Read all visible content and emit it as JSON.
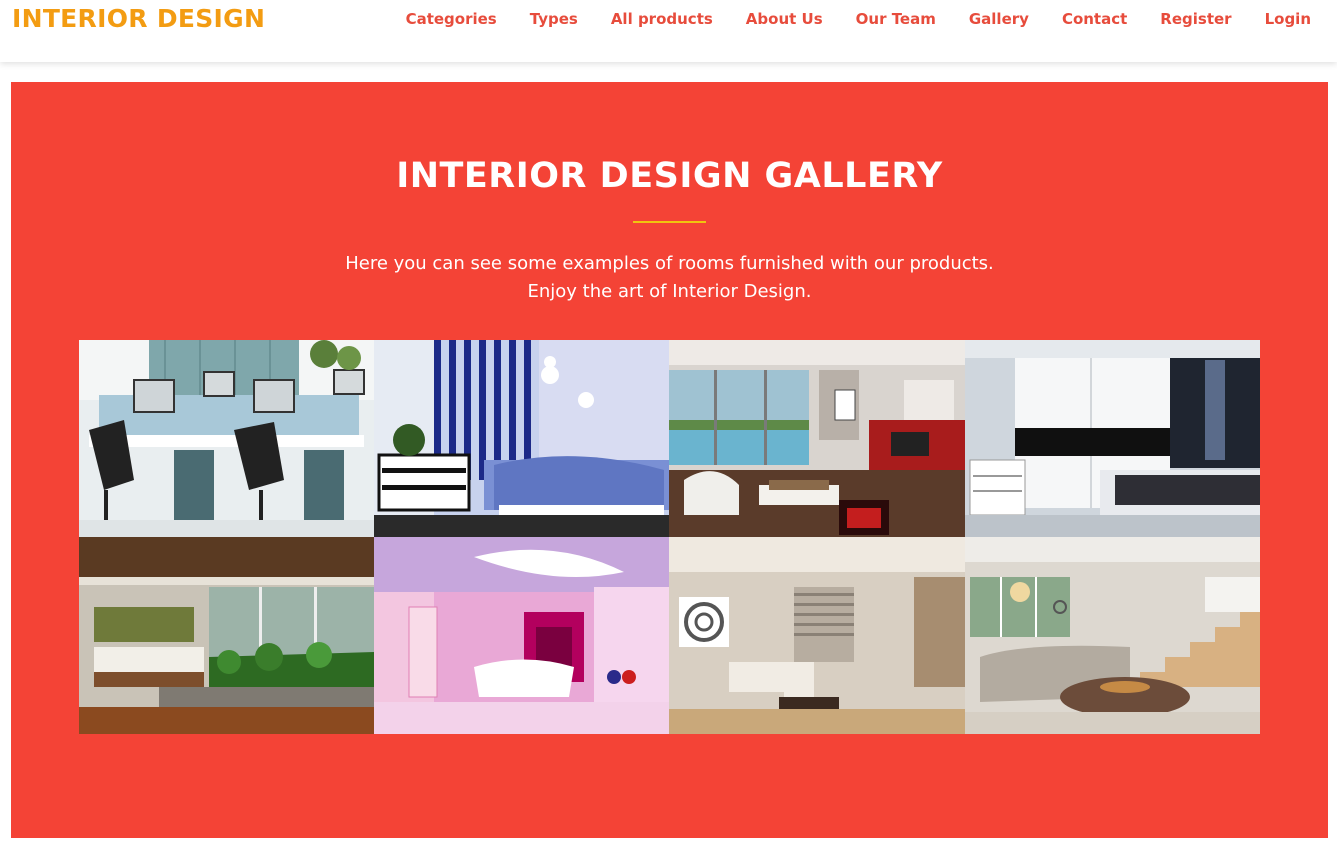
{
  "brand": {
    "name": "INTERIOR DESIGN"
  },
  "nav": {
    "items": [
      {
        "label": "Categories",
        "id": "categories"
      },
      {
        "label": "Types",
        "id": "types"
      },
      {
        "label": "All products",
        "id": "all-products"
      },
      {
        "label": "About Us",
        "id": "about-us"
      },
      {
        "label": "Our Team",
        "id": "our-team"
      },
      {
        "label": "Gallery",
        "id": "gallery"
      },
      {
        "label": "Contact",
        "id": "contact"
      },
      {
        "label": "Register",
        "id": "register"
      },
      {
        "label": "Login",
        "id": "login"
      }
    ]
  },
  "gallery": {
    "title": "INTERIOR DESIGN GALLERY",
    "description_line1": "Here you can see some examples of rooms furnished with our products.",
    "description_line2": "Enjoy the art of Interior Design.",
    "images": [
      {
        "subject": "office-workstations-photo"
      },
      {
        "subject": "striped-bedroom-photo"
      },
      {
        "subject": "living-room-pool-view-photo"
      },
      {
        "subject": "white-wardrobe-bedroom-photo"
      },
      {
        "subject": "loft-bedroom-plants-photo"
      },
      {
        "subject": "pink-futuristic-interior-photo"
      },
      {
        "subject": "beige-living-room-photo"
      },
      {
        "subject": "living-room-staircase-photo"
      }
    ]
  },
  "colors": {
    "brand": "#f39c12",
    "nav_link": "#e74c3c",
    "section_bg": "#f44336",
    "divider": "#f1c40f",
    "white": "#ffffff"
  }
}
